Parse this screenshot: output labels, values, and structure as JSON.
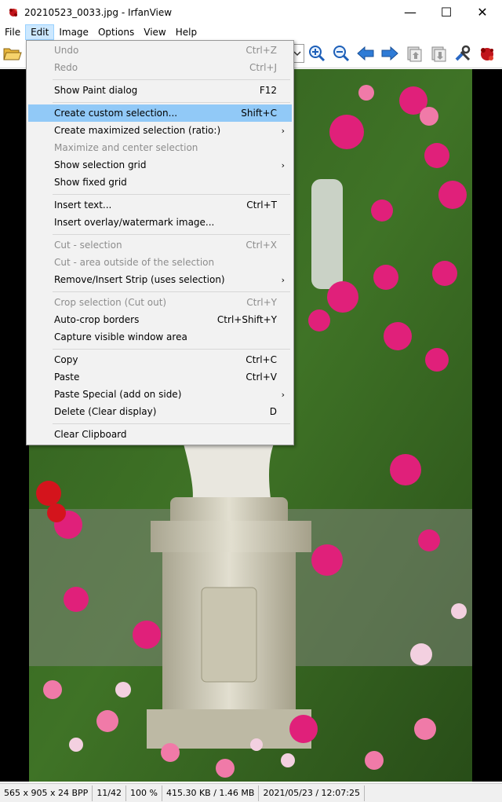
{
  "window": {
    "title": "20210523_0033.jpg - IrfanView",
    "minimize_glyph": "—",
    "maximize_glyph": "☐",
    "close_glyph": "✕"
  },
  "menubar": [
    "File",
    "Edit",
    "Image",
    "Options",
    "View",
    "Help"
  ],
  "toolbar": {
    "icons": [
      "open-folder-icon",
      "dropdown-arrow-icon",
      "zoom-in-icon",
      "zoom-out-icon",
      "previous-arrow-icon",
      "next-arrow-icon",
      "upload-icon",
      "download-icon",
      "tools-icon",
      "irfanview-logo-icon"
    ]
  },
  "edit_menu": {
    "items": [
      {
        "label": "Undo",
        "shortcut": "Ctrl+Z",
        "disabled": true
      },
      {
        "label": "Redo",
        "shortcut": "Ctrl+J",
        "disabled": true
      },
      {
        "label": "Show Paint dialog",
        "shortcut": "F12"
      },
      {
        "label": "Create custom selection...",
        "shortcut": "Shift+C",
        "highlight": true
      },
      {
        "label": "Create maximized selection (ratio:)",
        "submenu": true
      },
      {
        "label": "Maximize and center selection",
        "disabled": true
      },
      {
        "label": "Show selection grid",
        "submenu": true
      },
      {
        "label": "Show fixed grid"
      },
      {
        "label": "Insert text...",
        "shortcut": "Ctrl+T"
      },
      {
        "label": "Insert overlay/watermark image..."
      },
      {
        "label": "Cut - selection",
        "shortcut": "Ctrl+X",
        "disabled": true
      },
      {
        "label": "Cut - area outside of the selection",
        "disabled": true
      },
      {
        "label": "Remove/Insert Strip (uses selection)",
        "submenu": true
      },
      {
        "label": "Crop selection (Cut out)",
        "shortcut": "Ctrl+Y",
        "disabled": true
      },
      {
        "label": "Auto-crop borders",
        "shortcut": "Ctrl+Shift+Y"
      },
      {
        "label": "Capture visible window area"
      },
      {
        "label": "Copy",
        "shortcut": "Ctrl+C"
      },
      {
        "label": "Paste",
        "shortcut": "Ctrl+V"
      },
      {
        "label": "Paste Special (add on side)",
        "submenu": true
      },
      {
        "label": "Delete (Clear display)",
        "shortcut": "D"
      },
      {
        "label": "Clear Clipboard"
      }
    ],
    "submenu_arrow": "›"
  },
  "statusbar": {
    "dimensions": "565 x 905 x 24 BPP",
    "index": "11/42",
    "zoom": "100 %",
    "filesize": "415.30 KB / 1.46 MB",
    "datetime": "2021/05/23 / 12:07:25"
  },
  "colors": {
    "menu_highlight": "#91c9f7",
    "disabled_text": "#8d8d8d",
    "menubar_active": "#cce8ff"
  }
}
